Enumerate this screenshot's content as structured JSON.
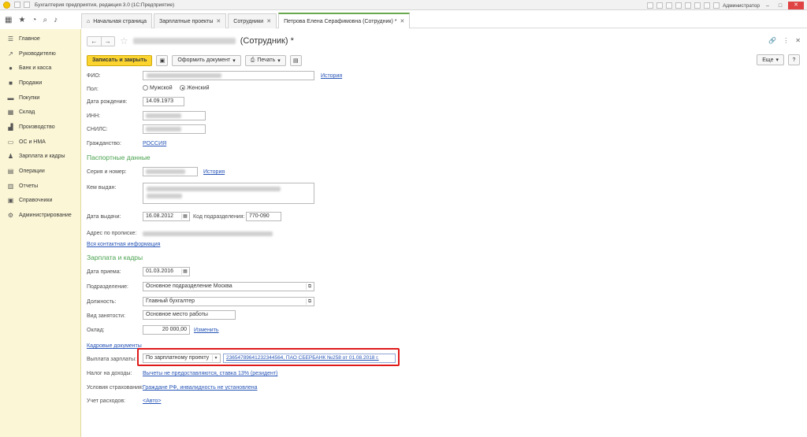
{
  "app": {
    "title": "Бухгалтерия предприятия, редакция 3.0  (1С:Предприятие)",
    "user": "Администратор"
  },
  "tabs": [
    {
      "label": "Начальная страница"
    },
    {
      "label": "Зарплатные проекты"
    },
    {
      "label": "Сотрудники"
    },
    {
      "label": "Петрова Елена Серафимовна (Сотрудник) *"
    }
  ],
  "sidebar": {
    "items": [
      {
        "label": "Главное",
        "icon": "menu-icon"
      },
      {
        "label": "Руководителю",
        "icon": "chart-icon"
      },
      {
        "label": "Банк и касса",
        "icon": "bank-icon"
      },
      {
        "label": "Продажи",
        "icon": "cart-icon"
      },
      {
        "label": "Покупки",
        "icon": "basket-icon"
      },
      {
        "label": "Склад",
        "icon": "warehouse-icon"
      },
      {
        "label": "Производство",
        "icon": "factory-icon"
      },
      {
        "label": "ОС и НМА",
        "icon": "assets-icon"
      },
      {
        "label": "Зарплата и кадры",
        "icon": "people-icon"
      },
      {
        "label": "Операции",
        "icon": "operations-icon"
      },
      {
        "label": "Отчеты",
        "icon": "reports-icon"
      },
      {
        "label": "Справочники",
        "icon": "book-icon"
      },
      {
        "label": "Администрирование",
        "icon": "gear-icon"
      }
    ]
  },
  "doc": {
    "title_suffix": "(Сотрудник) *"
  },
  "cmd": {
    "save_close": "Записать и закрыть",
    "create_doc": "Оформить документ",
    "print": "Печать",
    "more": "Еще",
    "help": "?"
  },
  "form": {
    "fio_label": "ФИО:",
    "history": "История",
    "gender_label": "Пол:",
    "male": "Мужской",
    "female": "Женский",
    "birth_label": "Дата рождения:",
    "birth_value": "14.09.1973",
    "inn_label": "ИНН:",
    "snils_label": "СНИЛС:",
    "citizen_label": "Гражданство:",
    "citizen_value": "РОССИЯ",
    "passport_header": "Паспортные данные",
    "series_label": "Серия и номер:",
    "issued_by_label": "Кем выдан:",
    "issue_date_label": "Дата выдачи:",
    "issue_date_value": "16.08.2012",
    "dept_code_label": "Код подразделения:",
    "dept_code_value": "770-090",
    "address_label": "Адрес по прописке:",
    "all_contacts": "Вся контактная информация",
    "salary_header": "Зарплата и кадры",
    "hire_label": "Дата приема:",
    "hire_value": "01.03.2016",
    "division_label": "Подразделение:",
    "division_value": "Основное подразделение Москва",
    "position_label": "Должность:",
    "position_value": "Главный бухгалтер",
    "employment_label": "Вид занятости:",
    "employment_value": "Основное место работы",
    "salary_label": "Оклад:",
    "salary_value": "20 000,00",
    "change": "Изменить",
    "hr_docs": "Кадровые документы",
    "payout_label": "Выплата зарплаты:",
    "payout_value": "По зарплатному проекту",
    "payout_account": "23654789641232344564, ПАО СБЕРБАНК №258      от 01.08.2018 г.",
    "tax_label": "Налог на доходы:",
    "tax_value": "Вычеты не предоставляются, ставка 13% (резидент)",
    "insurance_label": "Условия страхования:",
    "insurance_value": "Граждане РФ, инвалидность не установлена",
    "expenses_label": "Учет расходов:",
    "expenses_value": "<Авто>"
  }
}
